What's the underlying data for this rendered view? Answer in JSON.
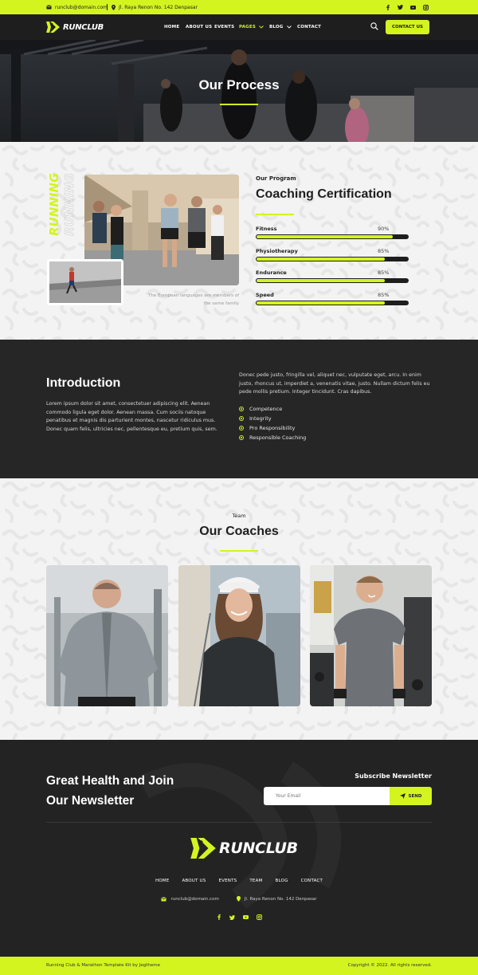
{
  "topbar": {
    "email": "runclub@domain.com",
    "address": "Jl. Raya Renon No. 142 Denpasar",
    "social_icons": [
      "facebook-icon",
      "twitter-icon",
      "youtube-icon",
      "instagram-icon"
    ]
  },
  "brand": {
    "name": "RUNCLUB",
    "accent": "#d4f41f",
    "dark": "#1e1e1e"
  },
  "nav": {
    "items": [
      {
        "label": "HOME"
      },
      {
        "label": "ABOUT US"
      },
      {
        "label": "EVENTS"
      },
      {
        "label": "PAGES",
        "active": true
      },
      {
        "label": "BLOG"
      },
      {
        "label": "CONTACT"
      }
    ],
    "contact_button": "CONTACT US"
  },
  "hero": {
    "title": "Our Process"
  },
  "program": {
    "subtitle": "Our Program",
    "title": "Coaching Certification",
    "vertical_word": "RUNNING",
    "caption": "The European languages are members of the same family",
    "skills": [
      {
        "label": "Fitness",
        "percent_text": "90%",
        "value": 90
      },
      {
        "label": "Physiotherapy",
        "percent_text": "85%",
        "value": 85
      },
      {
        "label": "Endurance",
        "percent_text": "85%",
        "value": 85
      },
      {
        "label": "Speed",
        "percent_text": "85%",
        "value": 85
      }
    ]
  },
  "intro": {
    "title": "Introduction",
    "left_text": "Lorem ipsum dolor sit amet, consectetuer adipiscing elit. Aenean commodo ligula eget dolor. Aenean massa. Cum sociis natoque penatibus et magnis dis parturient montes, nascetur ridiculus mus. Donec quam felis, ultricies nec, pellentesque eu, pretium quis, sem.",
    "right_text": "Donec pede justo, fringilla vel, aliquet nec, vulputate eget, arcu. In enim justo, rhoncus ut, imperdiet a, venenatis vitae, justo. Nullam dictum felis eu pede mollis pretium. Integer tincidunt. Cras dapibus.",
    "checklist": [
      "Competence",
      "Integrity",
      "Pro Responsibility",
      "Responsible Coaching"
    ]
  },
  "coaches": {
    "subtitle": "Team",
    "title": "Our Coaches"
  },
  "newsletter": {
    "title_line1": "Great Health and Join",
    "title_line2": "Our Newsletter",
    "subscribe_label": "Subscribe Newsletter",
    "email_placeholder": "Your Email",
    "send_label": "SEND"
  },
  "footer": {
    "nav": [
      "HOME",
      "ABOUT US",
      "EVENTS",
      "TEAM",
      "BLOG",
      "CONTACT"
    ],
    "email": "runclub@domain.com",
    "address": "Jl. Raya Renon No. 142 Denpasar",
    "credit": "Running Club & Marathon Template Kit by Jegtheme",
    "copyright": "Copyright © 2022. All rights reserved."
  }
}
